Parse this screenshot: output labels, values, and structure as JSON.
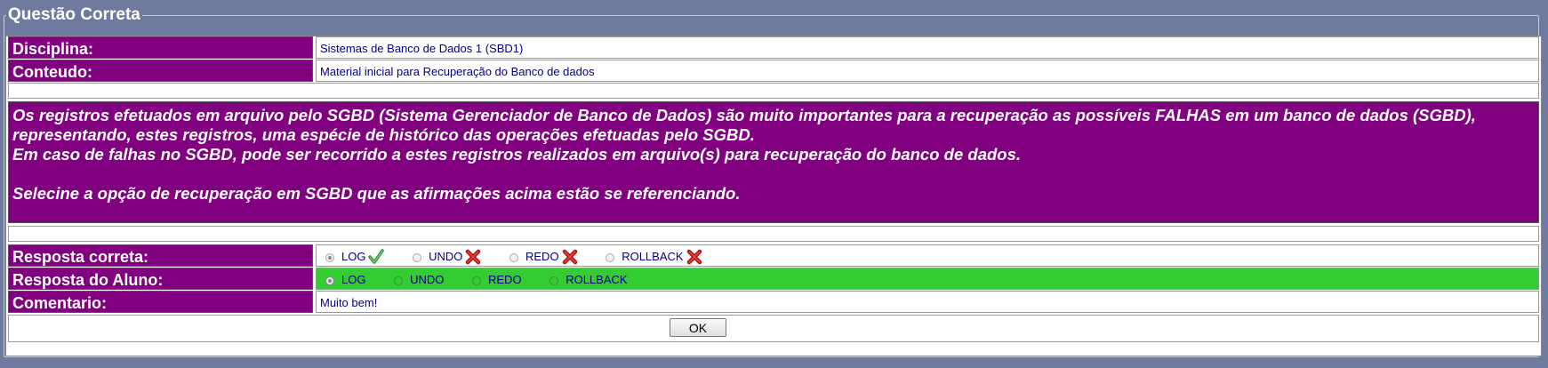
{
  "legend": "Questão Correta",
  "disciplina": {
    "label": "Disciplina:",
    "value": "Sistemas de Banco de Dados 1 (SBD1)"
  },
  "conteudo": {
    "label": "Conteudo:",
    "value": "Material inicial para Recuperação do Banco de dados"
  },
  "question": {
    "line1": "Os registros efetuados em arquivo pelo SGBD (Sistema Gerenciador de Banco de Dados) são muito importantes para a recuperação as possíveis FALHAS em um banco de dados (SGBD), representando, estes registros, uma espécie de histórico das operações efetuadas pelo SGBD.",
    "line2": "Em caso de falhas no SGBD, pode ser recorrido a estes registros realizados em arquivo(s) para recuperação do banco de dados.",
    "line3": "Selecine a opção de recuperação em SGBD que as afirmações acima estão se referenciando."
  },
  "resposta_correta": {
    "label": "Resposta correta:",
    "options": [
      {
        "label": "LOG",
        "checked": true,
        "mark": "check-icon"
      },
      {
        "label": "UNDO",
        "checked": false,
        "mark": "cross-icon"
      },
      {
        "label": "REDO",
        "checked": false,
        "mark": "cross-icon"
      },
      {
        "label": "ROLLBACK",
        "checked": false,
        "mark": "cross-icon"
      }
    ]
  },
  "resposta_aluno": {
    "label": "Resposta do Aluno:",
    "options": [
      {
        "label": "LOG",
        "checked": true
      },
      {
        "label": "UNDO",
        "checked": false
      },
      {
        "label": "REDO",
        "checked": false
      },
      {
        "label": "ROLLBACK",
        "checked": false
      }
    ]
  },
  "comentario": {
    "label": "Comentario:",
    "value": "Muito bem!"
  },
  "ok_button": "OK",
  "colors": {
    "background": "#6e7b9e",
    "label_bg": "#800080",
    "student_bg": "#33cc33",
    "value_text": "#000080"
  }
}
